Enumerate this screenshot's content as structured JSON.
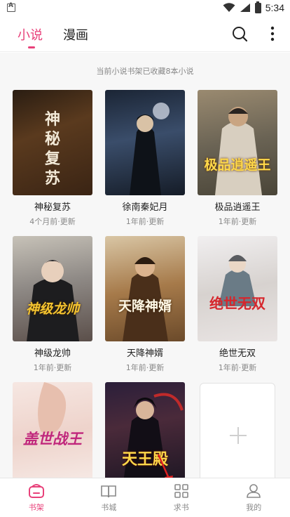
{
  "status_bar": {
    "time": "5:34"
  },
  "header": {
    "tabs": [
      {
        "label": "小说",
        "active": true
      },
      {
        "label": "漫画",
        "active": false
      }
    ]
  },
  "shelf": {
    "count_text": "当前小说书架已收藏8本小说",
    "books": [
      {
        "title": "神秘复苏",
        "updated": "4个月前·更新",
        "cover_text": "神秘复苏"
      },
      {
        "title": "徐南秦妃月",
        "updated": "1年前·更新",
        "cover_text": ""
      },
      {
        "title": "极品逍遥王",
        "updated": "1年前·更新",
        "cover_text": "极品逍遥王"
      },
      {
        "title": "神级龙帅",
        "updated": "1年前·更新",
        "cover_text": "神级龙帅"
      },
      {
        "title": "天降神婿",
        "updated": "1年前·更新",
        "cover_text": "天降神婿"
      },
      {
        "title": "绝世无双",
        "updated": "1年前·更新",
        "cover_text": "绝世无双"
      },
      {
        "title": "",
        "updated": "",
        "cover_text": "盖世战王"
      },
      {
        "title": "",
        "updated": "",
        "cover_text": "天王殿"
      }
    ]
  },
  "bottom_nav": {
    "items": [
      {
        "label": "书架",
        "icon": "bookshelf-icon",
        "active": true
      },
      {
        "label": "书城",
        "icon": "book-open-icon",
        "active": false
      },
      {
        "label": "求书",
        "icon": "grid-icon",
        "active": false
      },
      {
        "label": "我的",
        "icon": "user-icon",
        "active": false
      }
    ]
  },
  "colors": {
    "accent": "#e8417a",
    "muted": "#888888",
    "background": "#f7f7f7"
  }
}
